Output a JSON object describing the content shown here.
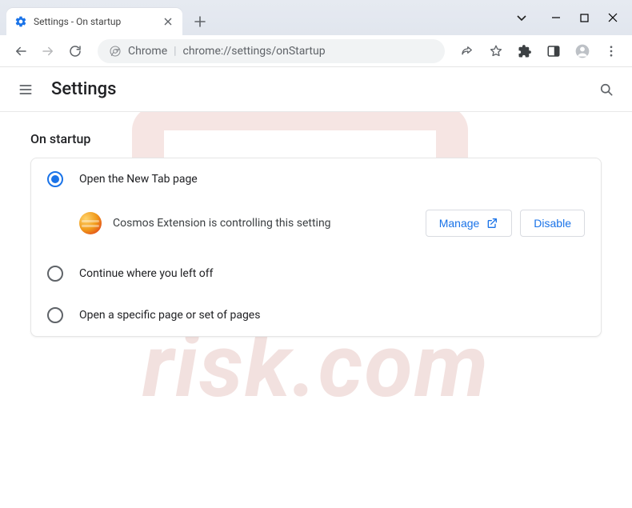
{
  "window": {
    "tab_title": "Settings - On startup"
  },
  "omnibox": {
    "chip": "Chrome",
    "url": "chrome://settings/onStartup"
  },
  "settings_header": {
    "title": "Settings"
  },
  "section": {
    "title": "On startup",
    "options": {
      "open_new_tab": "Open the New Tab page",
      "continue": "Continue where you left off",
      "specific": "Open a specific page or set of pages"
    },
    "controlled_by": "Cosmos Extension is controlling this setting",
    "buttons": {
      "manage": "Manage",
      "disable": "Disable"
    }
  }
}
